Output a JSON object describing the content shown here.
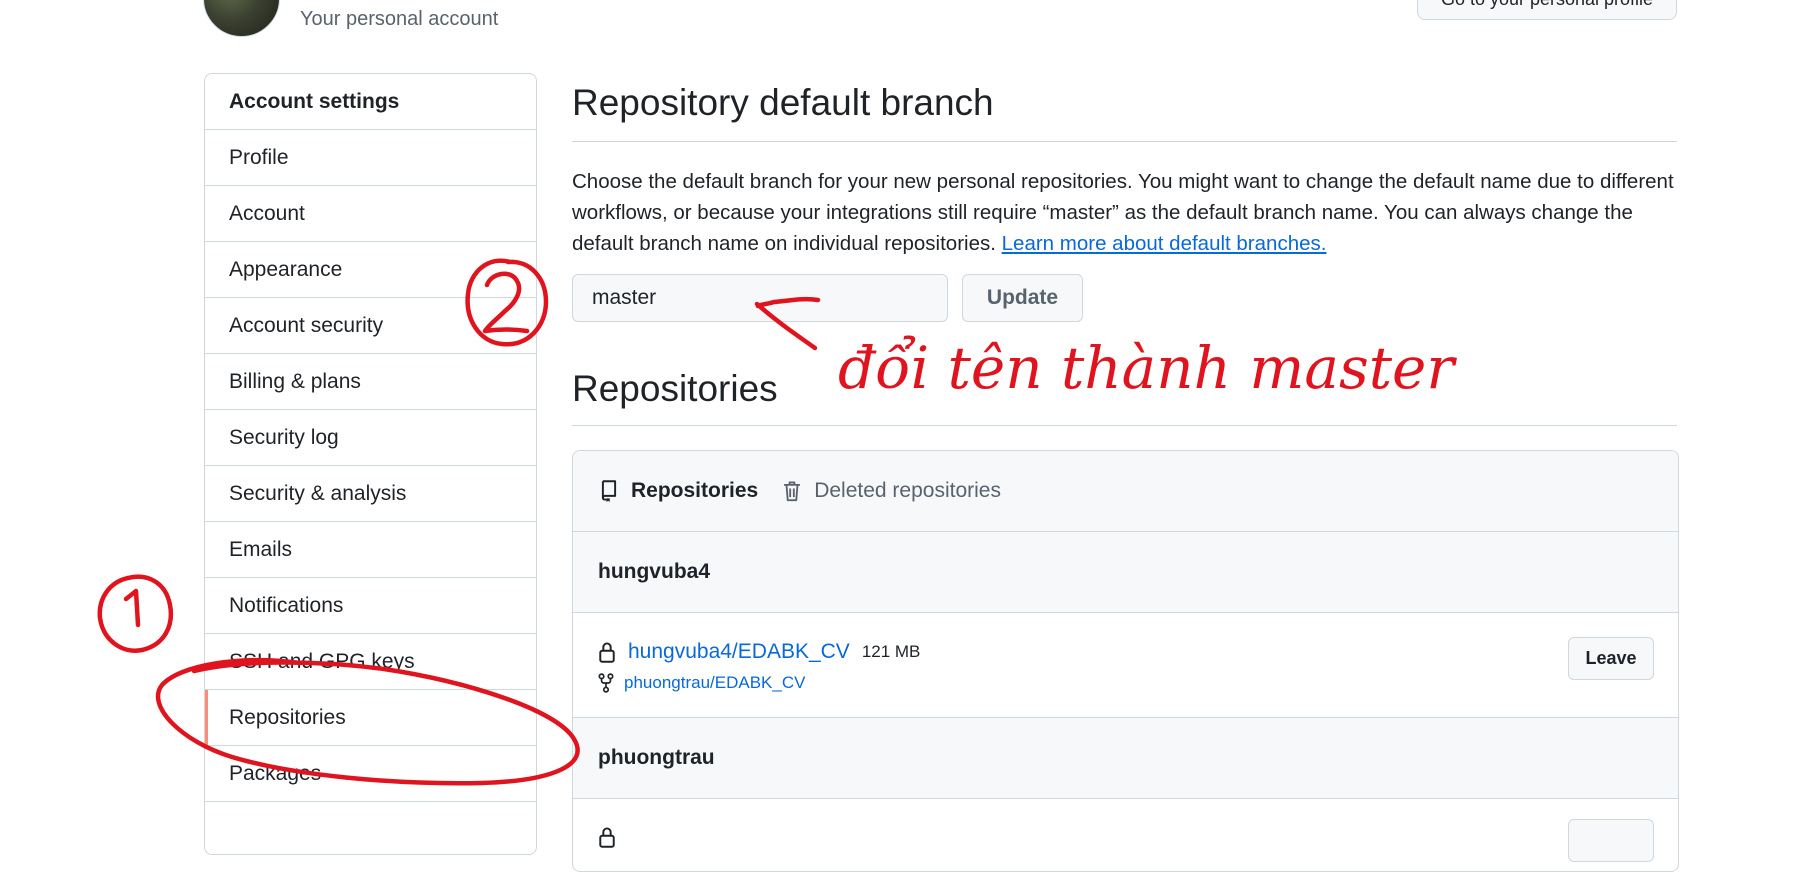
{
  "header": {
    "subtitle": "Your personal account",
    "profile_button": "Go to your personal profile"
  },
  "sidebar": {
    "items": [
      {
        "label": "Account settings"
      },
      {
        "label": "Profile"
      },
      {
        "label": "Account"
      },
      {
        "label": "Appearance"
      },
      {
        "label": "Account security"
      },
      {
        "label": "Billing & plans"
      },
      {
        "label": "Security log"
      },
      {
        "label": "Security & analysis"
      },
      {
        "label": "Emails"
      },
      {
        "label": "Notifications"
      },
      {
        "label": "SSH and GPG keys"
      },
      {
        "label": "Repositories"
      },
      {
        "label": "Packages"
      }
    ]
  },
  "branch": {
    "title": "Repository default branch",
    "description": "Choose the default branch for your new personal repositories. You might want to change the default name due to different workflows, or because your integrations still require “master” as the default branch name. You can always change the default branch name on individual repositories.",
    "learn_more": "Learn more about default branches.",
    "input_value": "master",
    "update_button": "Update"
  },
  "repositories": {
    "title": "Repositories",
    "tabs": [
      {
        "label": "Repositories",
        "icon": "repo-icon"
      },
      {
        "label": "Deleted repositories",
        "icon": "trash-icon"
      }
    ],
    "groups": [
      {
        "owner": "hungvuba4",
        "repos": [
          {
            "name": "hungvuba4/EDABK_CV",
            "size": "121 MB",
            "fork_of": "phuongtrau/EDABK_CV",
            "action": "Leave"
          }
        ]
      },
      {
        "owner": "phuongtrau"
      }
    ]
  },
  "annotations": {
    "marker_1": "1",
    "marker_2": "2",
    "handwritten_note": "đổi tên thành master",
    "color": "#e0141e"
  }
}
